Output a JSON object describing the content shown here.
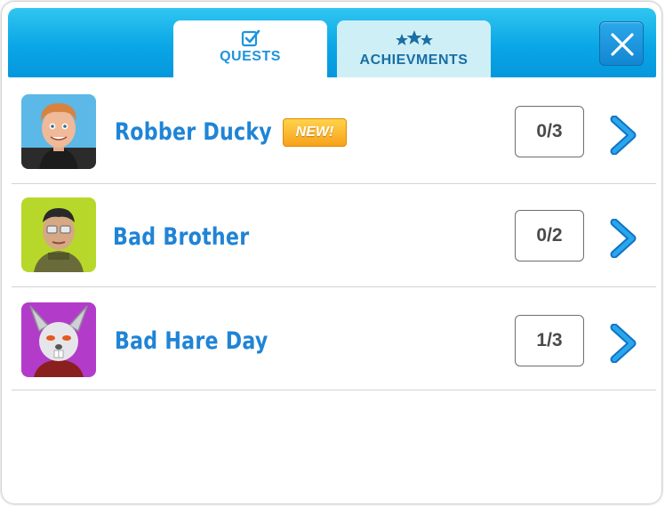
{
  "tabs": [
    {
      "label": "QUESTS",
      "icon": "checkbox-icon",
      "active": true
    },
    {
      "label": "ACHIEVMENTS",
      "icon": "three-stars-icon",
      "active": false
    }
  ],
  "close_button": {
    "icon": "close-icon"
  },
  "quests": [
    {
      "title": "Robber Ducky",
      "badge": "NEW!",
      "progress": "0/3",
      "avatar": "ginger-man-avatar"
    },
    {
      "title": "Bad Brother",
      "badge": "",
      "progress": "0/2",
      "avatar": "soldier-glasses-avatar"
    },
    {
      "title": "Bad Hare Day",
      "badge": "",
      "progress": "1/3",
      "avatar": "grey-hare-avatar"
    }
  ],
  "colors": {
    "header_blue": "#0aa6e6",
    "title_blue": "#1f84d6",
    "badge_orange": "#f7a21b",
    "progress_text": "#4a4a4a"
  }
}
